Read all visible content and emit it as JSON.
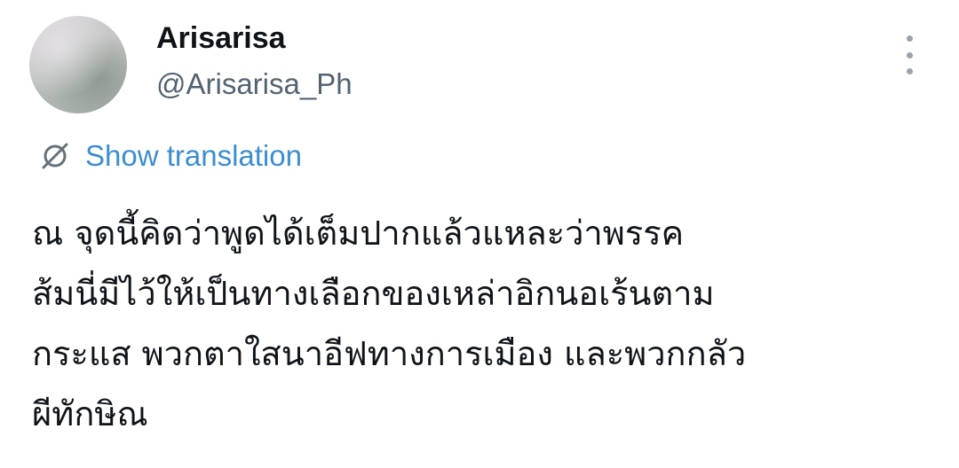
{
  "author": {
    "display_name": "Arisarisa",
    "handle": "@Arisarisa_Ph"
  },
  "translation": {
    "label": "Show translation",
    "icon": "translate-slash-icon"
  },
  "more": {
    "icon": "more-vertical-icon"
  },
  "tweet": {
    "lines": [
      "ณ จุดนี้คิดว่าพูดได้เต็มปากแล้วแหละว่าพรรค",
      "ส้มนี่มีไว้ให้เป็นทางเลือกของเหล่าอิกนอเร้นตาม",
      "กระแส พวกตาใสนาอีฟทางการเมือง และพวกกลัว",
      "ผีทักษิณ"
    ]
  },
  "colors": {
    "link": "#3b8ed0",
    "handle": "#536471",
    "text": "#0f1419",
    "background": "#ffffff"
  }
}
